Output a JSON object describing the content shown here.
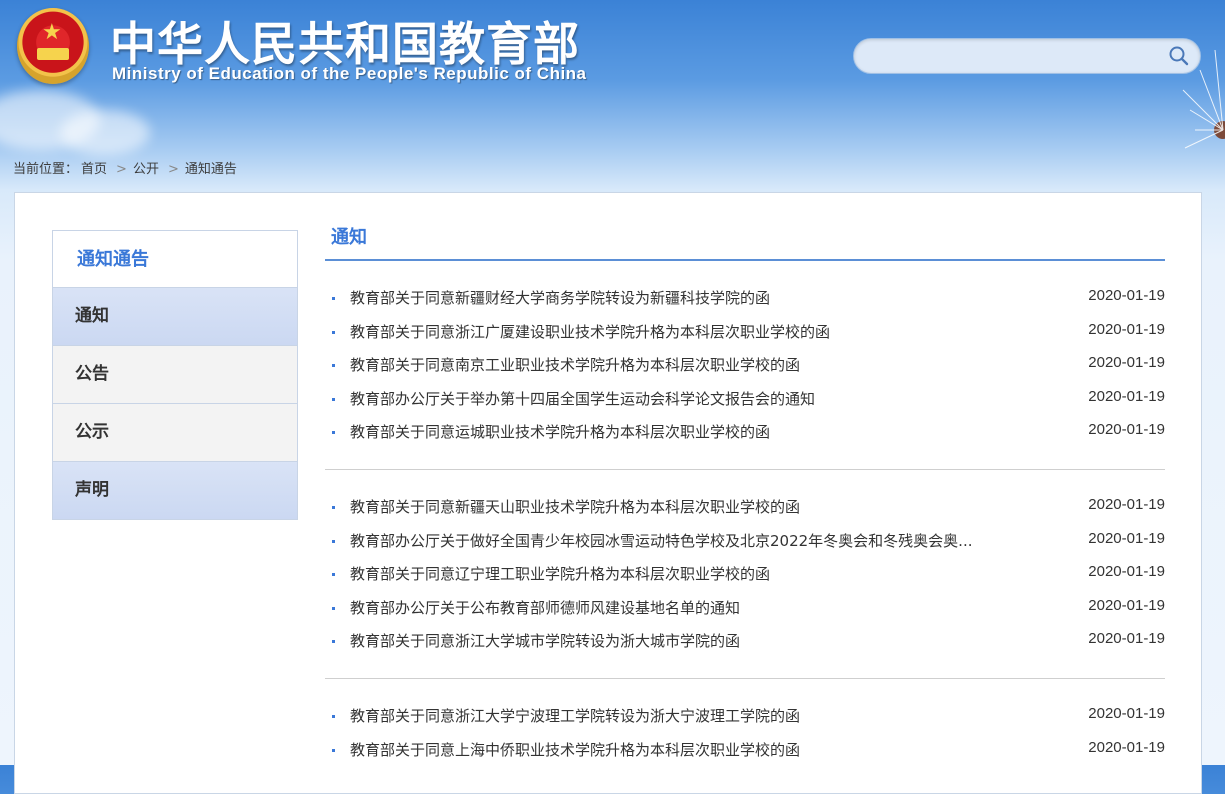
{
  "header": {
    "title_cn": "中华人民共和国教育部",
    "title_en": "Ministry of Education of the People's Republic of China",
    "search": {
      "value": "",
      "placeholder": ""
    }
  },
  "breadcrumb": {
    "prefix": "当前位置：",
    "items": [
      "首页",
      "公开",
      "通知通告"
    ],
    "separator": ">"
  },
  "sidebar": {
    "heading": "通知通告",
    "items": [
      {
        "label": "通知",
        "active": true
      },
      {
        "label": "公告",
        "active": false
      },
      {
        "label": "公示",
        "active": false
      },
      {
        "label": "声明",
        "active": true
      }
    ]
  },
  "content": {
    "title": "通知",
    "groups": [
      [
        {
          "title": "教育部关于同意新疆财经大学商务学院转设为新疆科技学院的函",
          "date": "2020-01-19"
        },
        {
          "title": "教育部关于同意浙江广厦建设职业技术学院升格为本科层次职业学校的函",
          "date": "2020-01-19"
        },
        {
          "title": "教育部关于同意南京工业职业技术学院升格为本科层次职业学校的函",
          "date": "2020-01-19"
        },
        {
          "title": "教育部办公厅关于举办第十四届全国学生运动会科学论文报告会的通知",
          "date": "2020-01-19"
        },
        {
          "title": "教育部关于同意运城职业技术学院升格为本科层次职业学校的函",
          "date": "2020-01-19"
        }
      ],
      [
        {
          "title": "教育部关于同意新疆天山职业技术学院升格为本科层次职业学校的函",
          "date": "2020-01-19"
        },
        {
          "title": "教育部办公厅关于做好全国青少年校园冰雪运动特色学校及北京2022年冬奥会和冬残奥会奥...",
          "date": "2020-01-19"
        },
        {
          "title": "教育部关于同意辽宁理工职业学院升格为本科层次职业学校的函",
          "date": "2020-01-19"
        },
        {
          "title": "教育部办公厅关于公布教育部师德师风建设基地名单的通知",
          "date": "2020-01-19"
        },
        {
          "title": "教育部关于同意浙江大学城市学院转设为浙大城市学院的函",
          "date": "2020-01-19"
        }
      ],
      [
        {
          "title": "教育部关于同意浙江大学宁波理工学院转设为浙大宁波理工学院的函",
          "date": "2020-01-19"
        },
        {
          "title": "教育部关于同意上海中侨职业技术学院升格为本科层次职业学校的函",
          "date": "2020-01-19"
        }
      ]
    ]
  }
}
